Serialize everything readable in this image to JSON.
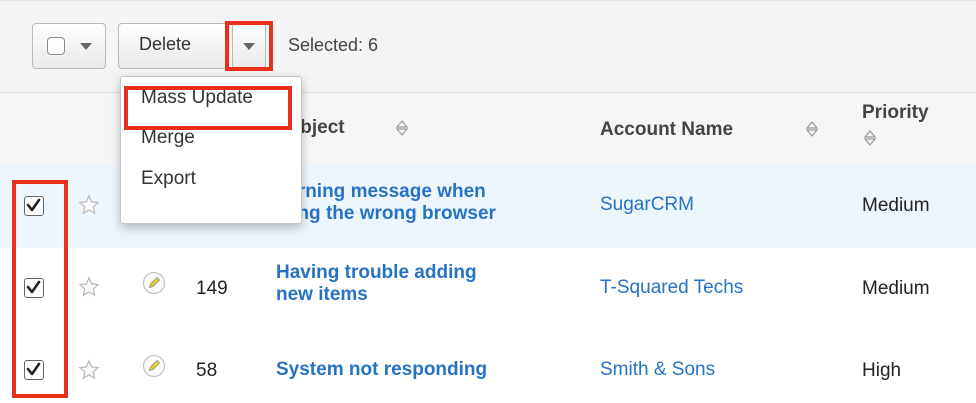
{
  "toolbar": {
    "delete_label": "Delete",
    "selected_text": "Selected: 6"
  },
  "dropdown": {
    "items": [
      "Mass Update",
      "Merge",
      "Export"
    ],
    "highlighted": "Mass Update"
  },
  "table": {
    "headers": {
      "subject": "Subject",
      "account": "Account Name",
      "priority": "Priority"
    },
    "rows": [
      {
        "checked": true,
        "number": "",
        "subject_lines": [
          "Warning message when",
          "using the wrong browser"
        ],
        "account": "SugarCRM",
        "priority": "Medium"
      },
      {
        "checked": true,
        "number": "149",
        "subject_lines": [
          "Having trouble adding",
          "new items"
        ],
        "account": "T-Squared Techs",
        "priority": "Medium"
      },
      {
        "checked": true,
        "number": "58",
        "subject_lines": [
          "System not responding"
        ],
        "account": "Smith & Sons",
        "priority": "High"
      }
    ]
  },
  "colors": {
    "link": "#2672c4",
    "highlight_frame": "#e8301c",
    "selected_row_bg": "#eef6fd"
  },
  "icons": [
    "checkbox-icon",
    "caret-down-icon",
    "sort-icon",
    "star-icon",
    "pencil-icon",
    "checkmark-icon"
  ]
}
